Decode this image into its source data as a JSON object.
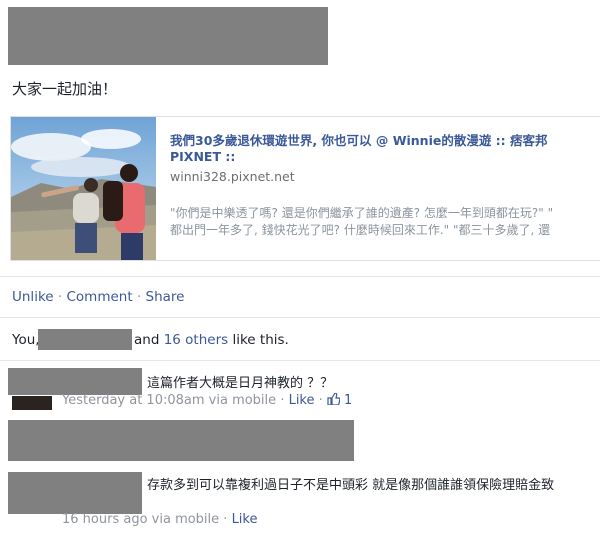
{
  "post": {
    "text": "大家一起加油！",
    "link": {
      "title": "我們30多歲退休環遊世界, 你也可以 @ Winnie的散漫遊 :: 痞客邦 PIXNET ::",
      "domain": "winni328.pixnet.net",
      "description_line1": "\"你們是中樂透了嗎? 還是你們繼承了誰的遺產? 怎麼一年到頭都在玩?\" \"",
      "description_line2": "都出門一年多了, 錢快花光了吧? 什麼時候回來工作.\" \"都三十多歲了, 還"
    }
  },
  "actions": {
    "unlike": "Unlike",
    "comment": "Comment",
    "share": "Share",
    "separator": "·"
  },
  "likes": {
    "you": "You,",
    "and": "and",
    "others": "16 others",
    "suffix": "like this."
  },
  "comments": [
    {
      "text": "這篇作者大概是日月神教的 ？？",
      "time": "Yesterday at 10:08am via mobile",
      "like_label": "Like",
      "like_count": "1",
      "icon": "thumbs-up-icon"
    },
    {
      "text": "存款多到可以靠複利過日子不是中頭彩 就是像那個誰誰領保險理賠金致",
      "time": "16 hours ago via mobile",
      "like_label": "Like"
    }
  ],
  "colors": {
    "link": "#3b5998",
    "meta": "#90949c",
    "redaction": "#808080"
  }
}
